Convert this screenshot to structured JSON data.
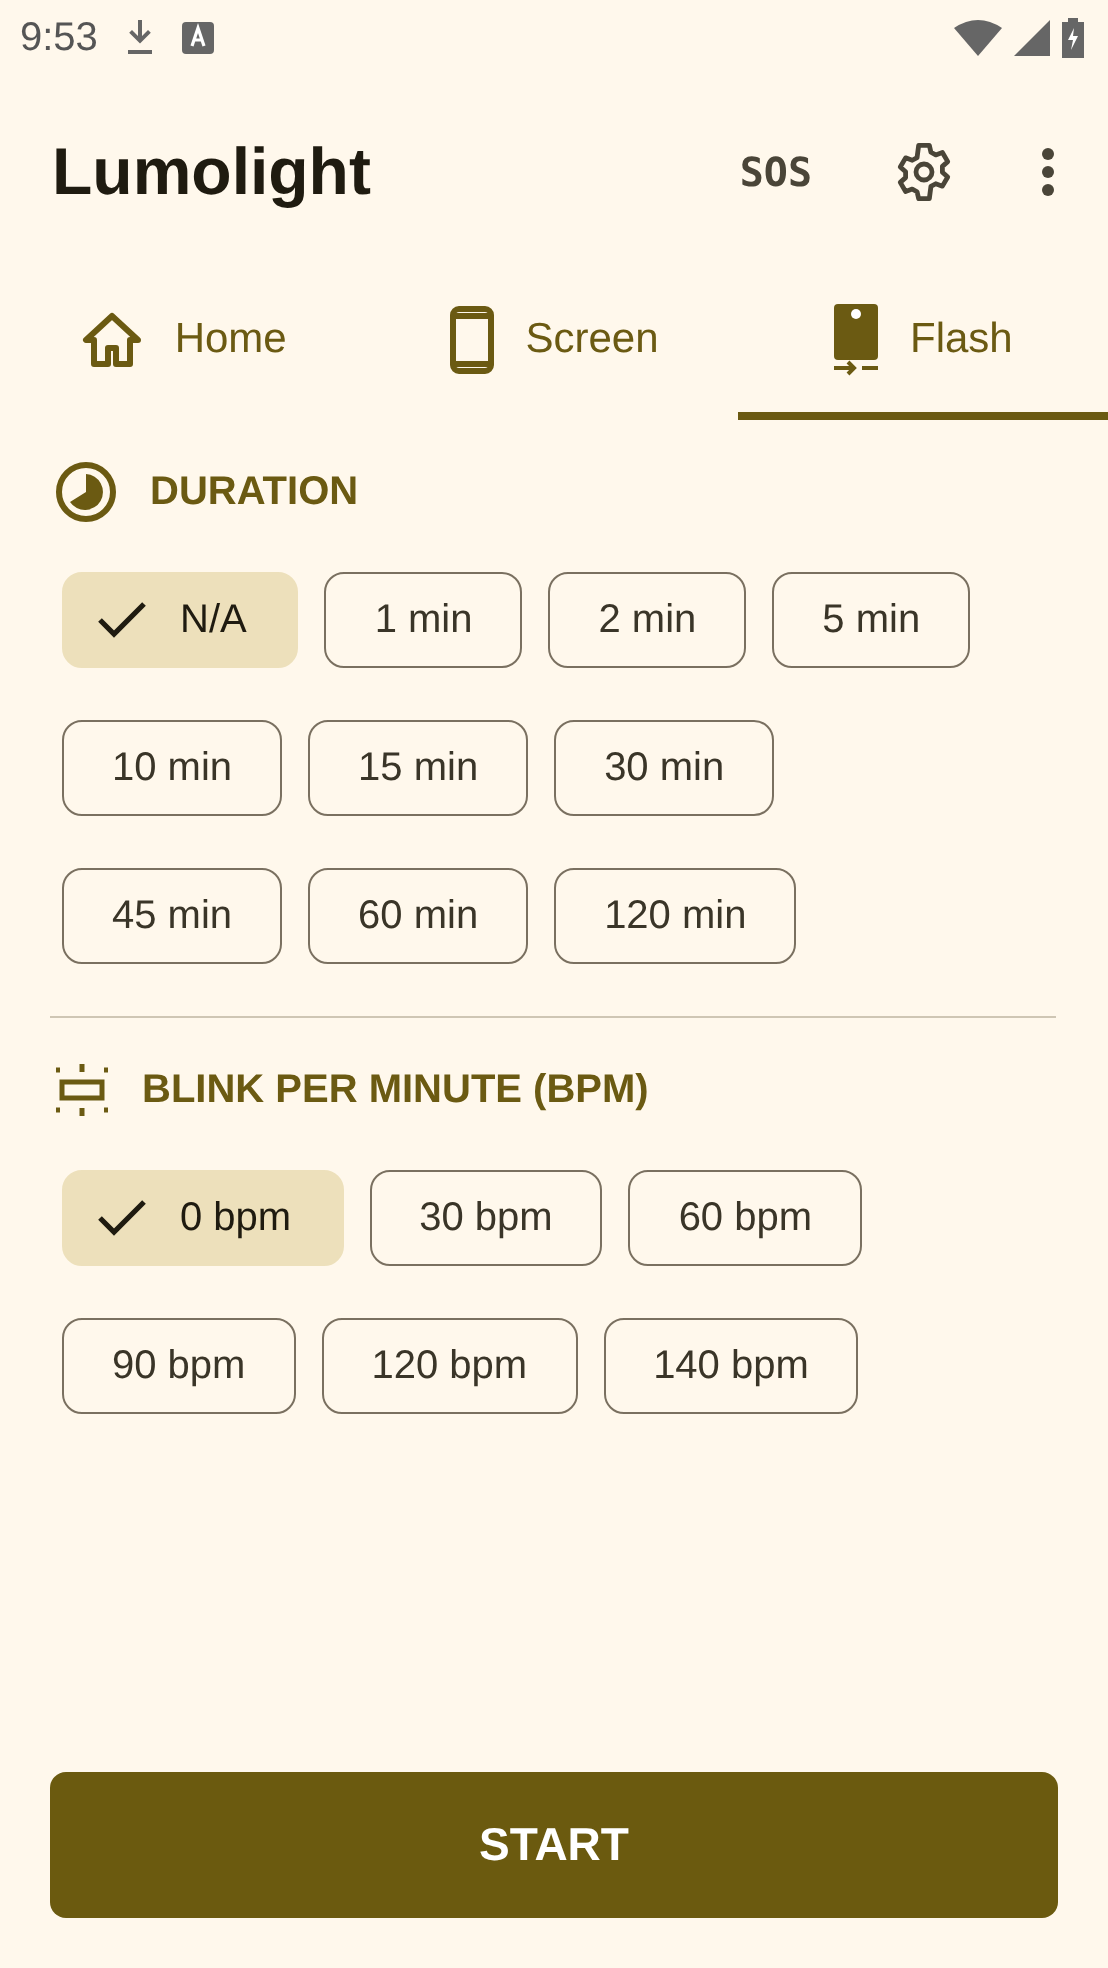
{
  "status_bar": {
    "time": "9:53"
  },
  "app_bar": {
    "title": "Lumolight",
    "sos": "SOS"
  },
  "tabs": [
    {
      "label": "Home",
      "kind": "home",
      "selected": false
    },
    {
      "label": "Screen",
      "kind": "screen",
      "selected": false
    },
    {
      "label": "Flash",
      "kind": "flash",
      "selected": true
    }
  ],
  "sections": [
    {
      "title": "DURATION",
      "kind": "duration",
      "rows": [
        [
          {
            "label": "N/A",
            "selected": true
          },
          {
            "label": "1 min",
            "selected": false
          },
          {
            "label": "2 min",
            "selected": false
          },
          {
            "label": "5 min",
            "selected": false
          }
        ],
        [
          {
            "label": "10 min",
            "selected": false
          },
          {
            "label": "15 min",
            "selected": false
          },
          {
            "label": "30 min",
            "selected": false
          }
        ],
        [
          {
            "label": "45 min",
            "selected": false
          },
          {
            "label": "60 min",
            "selected": false
          },
          {
            "label": "120 min",
            "selected": false
          }
        ]
      ]
    },
    {
      "title": "BLINK PER MINUTE (BPM)",
      "kind": "bpm",
      "rows": [
        [
          {
            "label": "0 bpm",
            "selected": true
          },
          {
            "label": "30 bpm",
            "selected": false
          },
          {
            "label": "60 bpm",
            "selected": false
          }
        ],
        [
          {
            "label": "90 bpm",
            "selected": false
          },
          {
            "label": "120 bpm",
            "selected": false
          },
          {
            "label": "140 bpm",
            "selected": false
          }
        ]
      ]
    }
  ],
  "start_button": "START"
}
